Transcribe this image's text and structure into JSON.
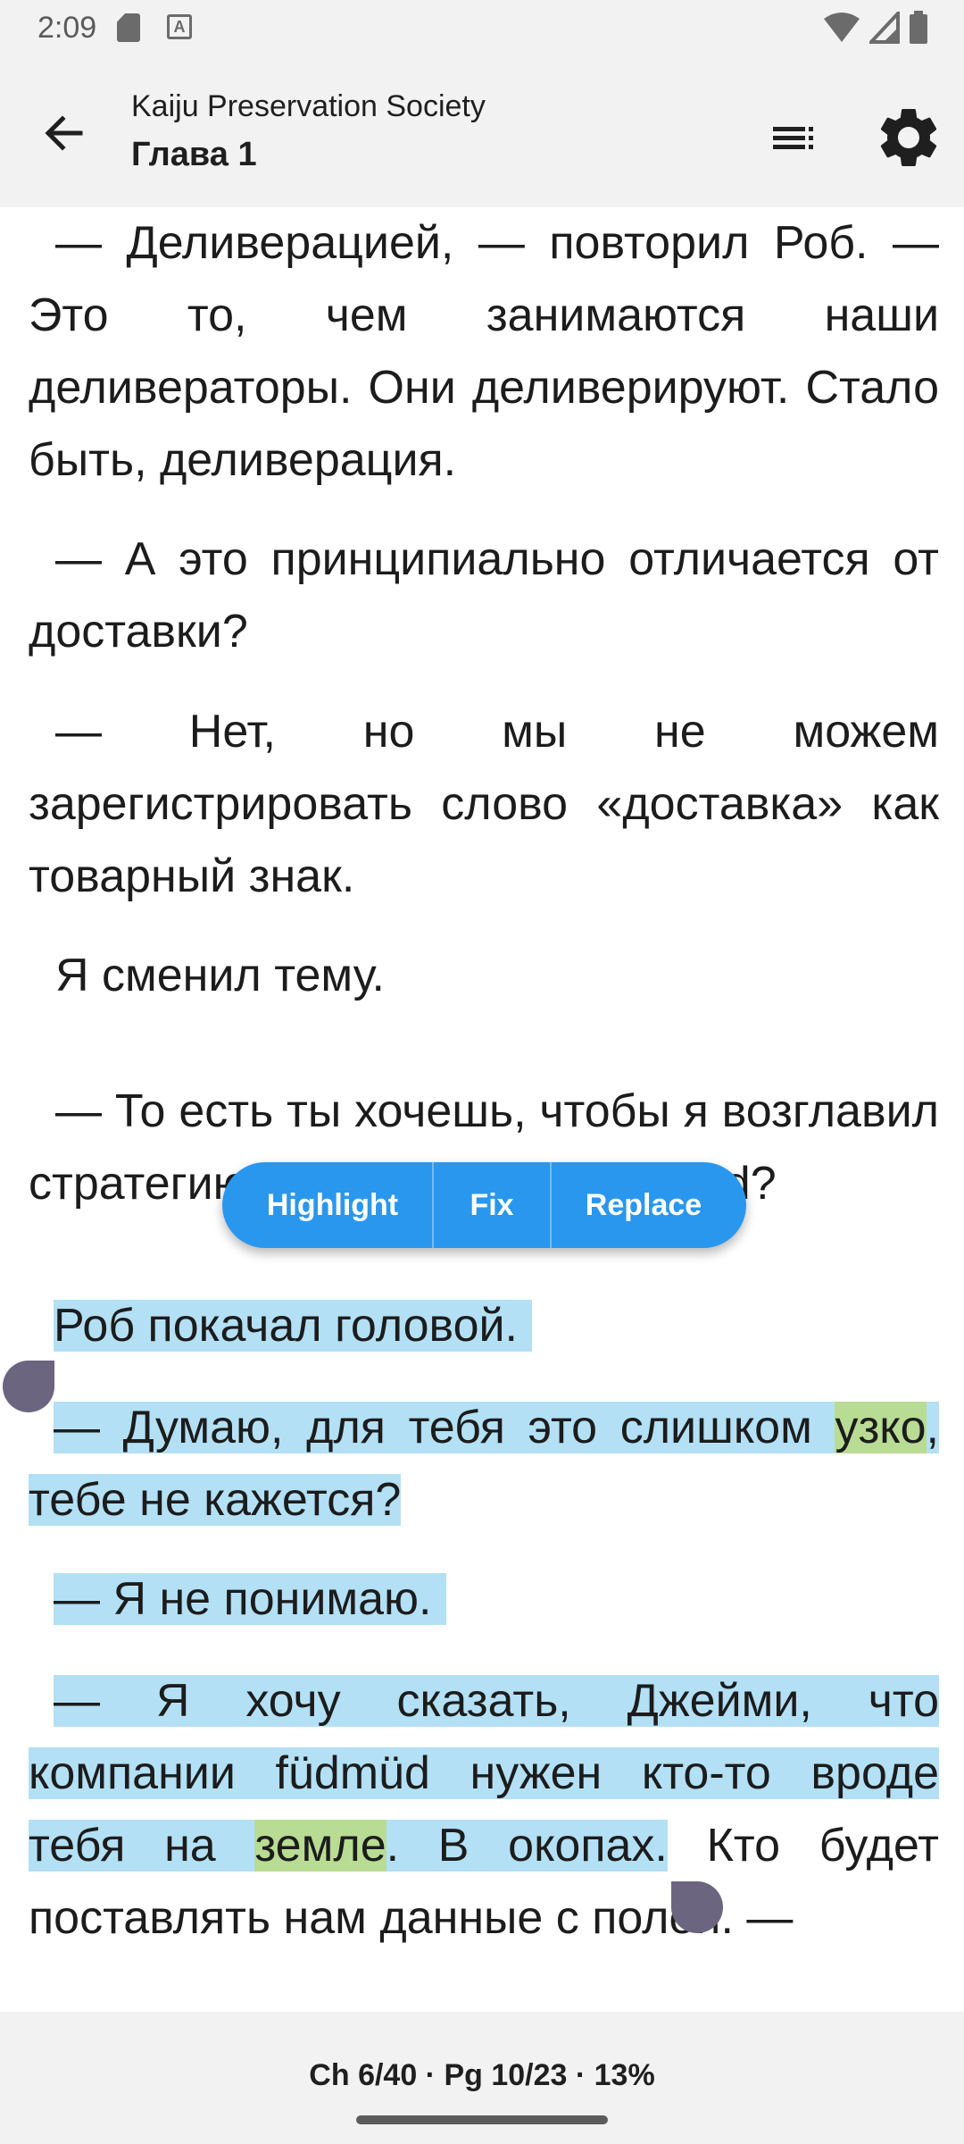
{
  "status_bar": {
    "time": "2:09",
    "icons": [
      "sd-card-icon",
      "a-notification-icon",
      "wifi-icon",
      "cell-signal-icon",
      "battery-icon"
    ]
  },
  "app_bar": {
    "book_title": "Kaiju Preservation Society",
    "chapter_title": "Глава 1"
  },
  "reader": {
    "p1": "— Деливерацией, — повторил Роб. — Это то, чем занимаются наши деливераторы. Они деливерируют. Стало быть, деливерация.",
    "p2": "— А это принципиально отличается от доставки?",
    "p3": "— Нет, но мы не можем зарегистрировать слово «доставка» как товарный знак.",
    "p4": "Я сменил тему.",
    "p5": "— То есть ты хочешь, чтобы я возглавил стратегию деливерации в füdmüd?",
    "p6": "Роб покачал головой.",
    "p7_a": "— Думаю, для тебя это слишком ",
    "p7_hl": "узко",
    "p7_b": ", тебе не кажется?",
    "p8": "— Я не понимаю.",
    "p9_a": "— Я хочу сказать, Джейми, что компании füdmüd нужен кто-то вроде тебя на ",
    "p9_hl": "земле",
    "p9_b": ". В окопах.",
    "p9_c": " Кто будет поставлять нам данные с полей. —"
  },
  "selection_menu": {
    "highlight": "Highlight",
    "fix": "Fix",
    "replace": "Replace"
  },
  "footer": {
    "progress": "Ch 6/40 · Pg 10/23 · 13%"
  },
  "colors": {
    "selection": "#b3e0f5",
    "highlight": "#b8dc93",
    "popup": "#2a97ee",
    "handle": "#6c6580"
  }
}
